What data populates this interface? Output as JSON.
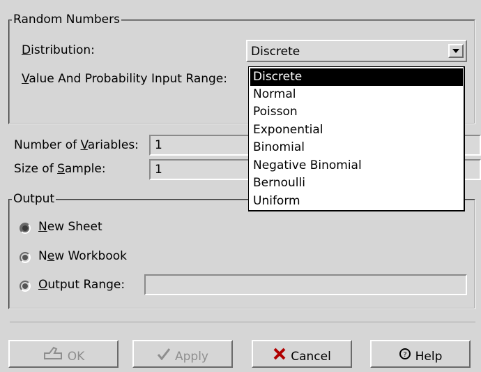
{
  "random_numbers": {
    "title": "Random Numbers",
    "distribution_label_u": "D",
    "distribution_label_rest": "istribution:",
    "distribution_value": "Discrete",
    "range_label_u": "V",
    "range_label_rest": "alue And Probability Input Range:"
  },
  "dropdown": {
    "options": [
      "Discrete",
      "Normal",
      "Poisson",
      "Exponential",
      "Binomial",
      "Negative Binomial",
      "Bernoulli",
      "Uniform"
    ],
    "selected": "Discrete"
  },
  "params": {
    "variables_label_a": "Number of ",
    "variables_label_u": "V",
    "variables_label_b": "ariables:",
    "variables_value": "1",
    "sample_label_a": "Size of ",
    "sample_label_u": "S",
    "sample_label_b": "ample:",
    "sample_value": "1"
  },
  "output": {
    "title": "Output",
    "new_sheet_u": "N",
    "new_sheet_rest": "ew Sheet",
    "new_workbook_a": "N",
    "new_workbook_u": "e",
    "new_workbook_b": "w Workbook",
    "range_u": "O",
    "range_rest": "utput Range:",
    "range_value": ""
  },
  "buttons": {
    "ok": "OK",
    "apply": "Apply",
    "cancel": "Cancel",
    "help": "Help"
  }
}
